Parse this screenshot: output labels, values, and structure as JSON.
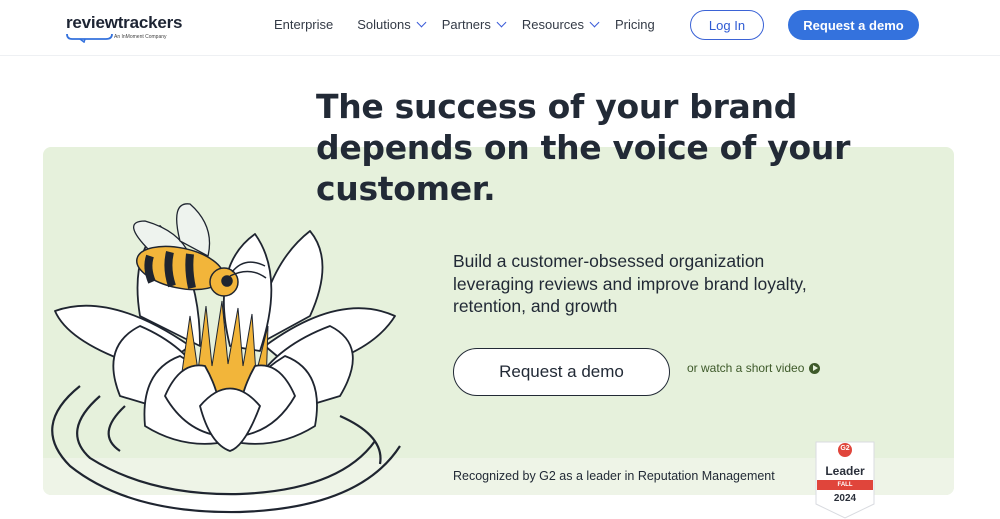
{
  "header": {
    "logo_text": "reviewtrackers",
    "logo_tagline": "An InMoment Company",
    "nav": [
      {
        "label": "Enterprise",
        "has_dropdown": false
      },
      {
        "label": "Solutions",
        "has_dropdown": true
      },
      {
        "label": "Partners",
        "has_dropdown": true
      },
      {
        "label": "Resources",
        "has_dropdown": true
      },
      {
        "label": "Pricing",
        "has_dropdown": false
      }
    ],
    "login_label": "Log In",
    "demo_label": "Request a demo"
  },
  "hero": {
    "headline_lines": [
      "The success of your brand",
      "depends on the voice of your",
      "customer."
    ],
    "sub_lines": [
      "Build a customer-obsessed organization",
      "leveraging reviews and improve brand loyalty,",
      "retention, and growth"
    ],
    "cta_label": "Request a demo",
    "video_link": "or watch a short video",
    "recognition": "Recognized by G2 as a leader in Reputation Management"
  },
  "badge": {
    "brand": "G2",
    "title": "Leader",
    "season": "FALL",
    "year": "2024"
  },
  "icons": {
    "dropdown": "chevron-down-icon",
    "play": "play-icon",
    "logo_bubble": "speech-bubble-icon"
  },
  "colors": {
    "primary_blue": "#3472dd",
    "hero_green": "#e6f1dc",
    "text_dark": "#222a36",
    "link_green": "#3e5a2a",
    "badge_red": "#e0453b"
  }
}
